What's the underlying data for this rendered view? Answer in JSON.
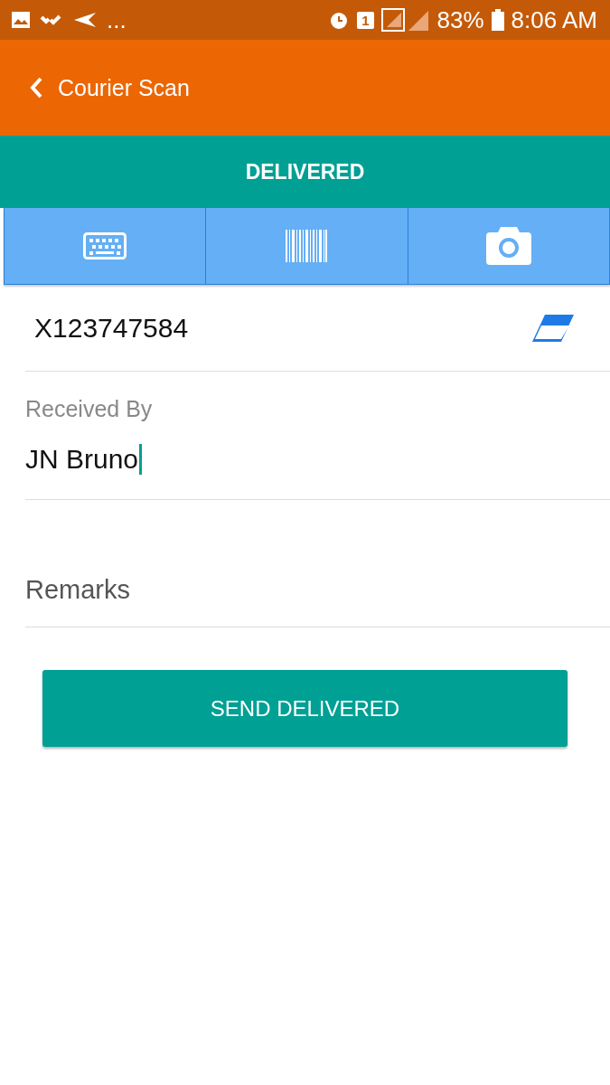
{
  "status_bar": {
    "more": "...",
    "sim": "1",
    "battery": "83%",
    "time": "8:06 AM"
  },
  "app_bar": {
    "title": "Courier Scan"
  },
  "status_header": "DELIVERED",
  "input_modes": [
    {
      "kind": "keyboard"
    },
    {
      "kind": "barcode"
    },
    {
      "kind": "camera"
    }
  ],
  "tracking_field": {
    "value": "X123747584"
  },
  "received_by": {
    "label": "Received By",
    "value": "JN Bruno"
  },
  "remarks": {
    "placeholder": "Remarks"
  },
  "submit_button": "SEND DELIVERED"
}
